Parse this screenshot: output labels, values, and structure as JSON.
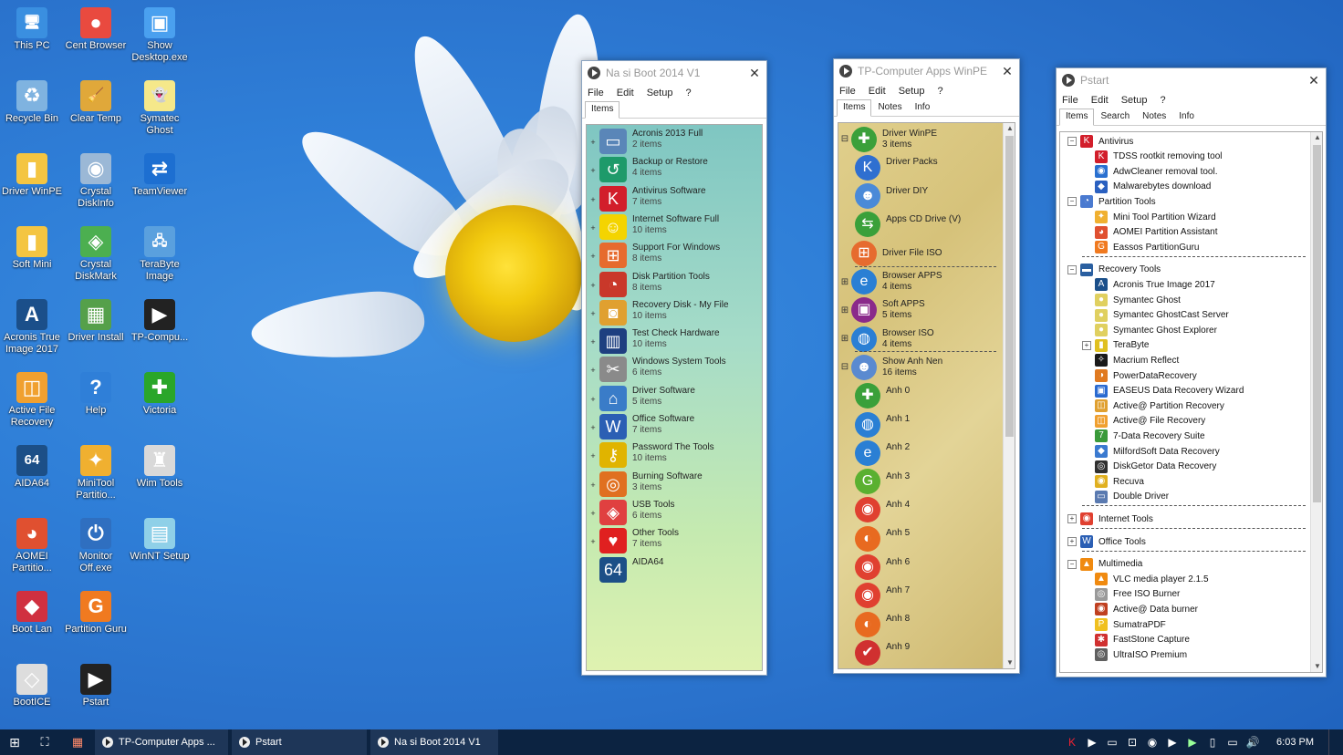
{
  "desktop": {
    "icons": [
      {
        "label": "This PC",
        "icon": "computer-icon",
        "color": "#3a8fe0",
        "glyph": "🖥"
      },
      {
        "label": "Cent Browser",
        "icon": "cent-browser-icon",
        "color": "#e94a3f",
        "glyph": "●"
      },
      {
        "label": "Show Desktop.exe",
        "icon": "show-desktop-icon",
        "color": "#4aa0ef",
        "glyph": "▣"
      },
      {
        "label": "Recycle Bin",
        "icon": "recycle-bin-icon",
        "color": "#7fb3e0",
        "glyph": "♻"
      },
      {
        "label": "Clear Temp",
        "icon": "broom-icon",
        "color": "#e0a83a",
        "glyph": "🧹"
      },
      {
        "label": "Symatec Ghost",
        "icon": "ghost-icon",
        "color": "#f5e88a",
        "glyph": "👻"
      },
      {
        "label": "Driver WinPE",
        "icon": "folder-icon",
        "color": "#f4c542",
        "glyph": "▮"
      },
      {
        "label": "Crystal DiskInfo",
        "icon": "crystal-diskinfo-icon",
        "color": "#9bb8d6",
        "glyph": "◉"
      },
      {
        "label": "TeamViewer",
        "icon": "teamviewer-icon",
        "color": "#1d6fd1",
        "glyph": "⇄"
      },
      {
        "label": "Soft Mini",
        "icon": "folder-icon",
        "color": "#f4c542",
        "glyph": "▮"
      },
      {
        "label": "Crystal DiskMark",
        "icon": "crystal-diskmark-icon",
        "color": "#4caf50",
        "glyph": "◈"
      },
      {
        "label": "TeraByte Image",
        "icon": "terabyte-icon",
        "color": "#5aa0de",
        "glyph": "🖧"
      },
      {
        "label": "Acronis True Image 2017",
        "icon": "acronis-icon",
        "color": "#1b4f8a",
        "glyph": "A"
      },
      {
        "label": "Driver Install",
        "icon": "driver-install-icon",
        "color": "#55a04a",
        "glyph": "▦"
      },
      {
        "label": "TP-Compu...",
        "icon": "play-icon",
        "color": "#222222",
        "glyph": "▶"
      },
      {
        "label": "Active File Recovery",
        "icon": "active-file-recovery-icon",
        "color": "#f0a030",
        "glyph": "◫"
      },
      {
        "label": "Help",
        "icon": "help-icon",
        "color": "#2f7fd8",
        "glyph": "?"
      },
      {
        "label": "Victoria",
        "icon": "victoria-plus-icon",
        "color": "#2aa62a",
        "glyph": "✚"
      },
      {
        "label": "AIDA64",
        "icon": "aida64-icon",
        "color": "#1c4f87",
        "glyph": "64"
      },
      {
        "label": "MiniTool Partitio...",
        "icon": "minitool-icon",
        "color": "#f0b030",
        "glyph": "✦"
      },
      {
        "label": "Wim Tools",
        "icon": "wim-tools-icon",
        "color": "#d9d9d9",
        "glyph": "♜"
      },
      {
        "label": "AOMEI Partitio...",
        "icon": "aomei-icon",
        "color": "#e05030",
        "glyph": "◕"
      },
      {
        "label": "Monitor Off.exe",
        "icon": "power-icon",
        "color": "#2f6fc0",
        "glyph": "⏻"
      },
      {
        "label": "WinNT Setup",
        "icon": "winnt-setup-icon",
        "color": "#8fd0e8",
        "glyph": "▤"
      },
      {
        "label": "Boot Lan",
        "icon": "boot-lan-icon",
        "color": "#d03040",
        "glyph": "◆"
      },
      {
        "label": "Partition Guru",
        "icon": "partition-guru-icon",
        "color": "#f07a20",
        "glyph": "G"
      },
      {
        "label": "",
        "icon": "blank-icon",
        "color": "#2f7fd8",
        "glyph": ""
      },
      {
        "label": "BootICE",
        "icon": "bootice-icon",
        "color": "#dddddd",
        "glyph": "◇"
      },
      {
        "label": "Pstart",
        "icon": "play-icon",
        "color": "#222222",
        "glyph": "▶"
      }
    ]
  },
  "windows": {
    "nasiboot": {
      "title": "Na si Boot 2014 V1",
      "menu": [
        "File",
        "Edit",
        "Setup",
        "?"
      ],
      "tabs": [
        "Items"
      ],
      "rows": [
        {
          "name": "Acronis 2013 Full",
          "count": "2 items",
          "icon": "acronis-icon",
          "color": "#5a86b8",
          "glyph": "▭"
        },
        {
          "name": "Backup or Restore",
          "count": "4 items",
          "icon": "backup-icon",
          "color": "#1e9a6a",
          "glyph": "↺"
        },
        {
          "name": "Antivirus Software",
          "count": "7 items",
          "icon": "kaspersky-icon",
          "color": "#d21e2b",
          "glyph": "K"
        },
        {
          "name": "Internet Software Full",
          "count": "10 items",
          "icon": "smiley-icon",
          "color": "#f4d400",
          "glyph": "☺"
        },
        {
          "name": "Support For Windows",
          "count": "8 items",
          "icon": "windows-flag-icon",
          "color": "#e66b2e",
          "glyph": "⊞"
        },
        {
          "name": "Disk Partition Tools",
          "count": "8 items",
          "icon": "partition-icon",
          "color": "#c9382a",
          "glyph": "◔"
        },
        {
          "name": "Recovery Disk - My File",
          "count": "10 items",
          "icon": "recovery-disk-icon",
          "color": "#e0a030",
          "glyph": "◙"
        },
        {
          "name": "Test Check Hardware",
          "count": "10 items",
          "icon": "hardware-test-icon",
          "color": "#1e3f80",
          "glyph": "▥"
        },
        {
          "name": "Windows System Tools",
          "count": "6 items",
          "icon": "tools-icon",
          "color": "#8a8a8a",
          "glyph": "✂"
        },
        {
          "name": "Driver Software",
          "count": "5 items",
          "icon": "driver-icon",
          "color": "#3a7cc8",
          "glyph": "⌂"
        },
        {
          "name": "Office Software",
          "count": "7 items",
          "icon": "word-icon",
          "color": "#2b5fb4",
          "glyph": "W"
        },
        {
          "name": "Password The Tools",
          "count": "10 items",
          "icon": "key-icon",
          "color": "#e0b400",
          "glyph": "⚷"
        },
        {
          "name": "Burning Software",
          "count": "3 items",
          "icon": "disc-burn-icon",
          "color": "#e07020",
          "glyph": "◎"
        },
        {
          "name": "USB Tools",
          "count": "6 items",
          "icon": "usb-icon",
          "color": "#e04040",
          "glyph": "◈"
        },
        {
          "name": "Other Tools",
          "count": "7 items",
          "icon": "heart-icon",
          "color": "#e02020",
          "glyph": "♥"
        },
        {
          "name": "AIDA64",
          "count": "",
          "icon": "aida64-icon",
          "color": "#1c4f87",
          "glyph": "64"
        }
      ]
    },
    "tpcomputer": {
      "title": "TP-Computer Apps WinPE",
      "menu": [
        "File",
        "Edit",
        "Setup",
        "?"
      ],
      "tabs": [
        "Items",
        "Notes",
        "Info"
      ],
      "groups": [
        {
          "name": "Driver WinPE",
          "count": "3 items",
          "icon": "plus-green-icon",
          "color": "#3aa03a",
          "glyph": "✚",
          "expand": "−",
          "children": [
            {
              "name": "Driver Packs",
              "icon": "kde-icon",
              "color": "#2f6fd0",
              "glyph": "K"
            },
            {
              "name": "Driver DIY",
              "icon": "finder-icon",
              "color": "#4a8ad8",
              "glyph": "☻"
            },
            {
              "name": "Apps CD Drive (V)",
              "icon": "arrows-icon",
              "color": "#3aa03a",
              "glyph": "⇆"
            }
          ]
        },
        {
          "name": "Driver File ISO",
          "count": "",
          "icon": "windows-flag-icon",
          "color": "#e66b2e",
          "glyph": "⊞",
          "expand": "",
          "children": []
        },
        {
          "name": "Browser APPS",
          "count": "4 items",
          "icon": "ie-icon",
          "color": "#2a7fd4",
          "glyph": "e",
          "expand": "+",
          "children": []
        },
        {
          "name": "Soft APPS",
          "count": "5 items",
          "icon": "apps-icon",
          "color": "#8a2a8a",
          "glyph": "▣",
          "expand": "+",
          "children": []
        },
        {
          "name": "Browser ISO",
          "count": "4 items",
          "icon": "globe-icon",
          "color": "#2a7fd4",
          "glyph": "◍",
          "expand": "+",
          "children": []
        },
        {
          "name": "Show Anh Nen",
          "count": "16 items",
          "icon": "users-icon",
          "color": "#5a8ad0",
          "glyph": "☻",
          "expand": "−",
          "children": [
            {
              "name": "Anh 0",
              "icon": "plus-green-icon",
              "color": "#3aa03a",
              "glyph": "✚"
            },
            {
              "name": "Anh 1",
              "icon": "globe-icon",
              "color": "#2a7fd4",
              "glyph": "◍"
            },
            {
              "name": "Anh 2",
              "icon": "ie-icon",
              "color": "#2a7fd4",
              "glyph": "e"
            },
            {
              "name": "Anh 3",
              "icon": "g-green-icon",
              "color": "#5ab030",
              "glyph": "G"
            },
            {
              "name": "Anh 4",
              "icon": "chrome-icon",
              "color": "#e04030",
              "glyph": "◉"
            },
            {
              "name": "Anh 5",
              "icon": "firefox-icon",
              "color": "#e86a20",
              "glyph": "◐"
            },
            {
              "name": "Anh 6",
              "icon": "chrome-icon",
              "color": "#e04030",
              "glyph": "◉"
            },
            {
              "name": "Anh 7",
              "icon": "chrome-icon",
              "color": "#e04030",
              "glyph": "◉"
            },
            {
              "name": "Anh 8",
              "icon": "firefox-icon",
              "color": "#e86a20",
              "glyph": "◐"
            },
            {
              "name": "Anh 9",
              "icon": "checkmark-icon",
              "color": "#d03030",
              "glyph": "✔"
            }
          ]
        }
      ]
    },
    "pstart": {
      "title": "Pstart",
      "menu": [
        "File",
        "Edit",
        "Setup",
        "?"
      ],
      "tabs": [
        "Items",
        "Search",
        "Notes",
        "Info"
      ],
      "tree": [
        {
          "level": 0,
          "exp": "−",
          "label": "Antivirus",
          "icon": "kaspersky-icon",
          "color": "#d21e2b",
          "glyph": "K"
        },
        {
          "level": 1,
          "exp": "",
          "label": "TDSS rootkit removing tool",
          "icon": "kaspersky-icon",
          "color": "#d21e2b",
          "glyph": "K"
        },
        {
          "level": 1,
          "exp": "",
          "label": "AdwCleaner removal tool.",
          "icon": "adwcleaner-icon",
          "color": "#2a70d0",
          "glyph": "◉"
        },
        {
          "level": 1,
          "exp": "",
          "label": "Malwarebytes download",
          "icon": "malwarebytes-icon",
          "color": "#2a60c0",
          "glyph": "◆"
        },
        {
          "level": 0,
          "exp": "−",
          "label": "Partition Tools",
          "icon": "partition-icon",
          "color": "#4a7ad0",
          "glyph": "◔"
        },
        {
          "level": 1,
          "exp": "",
          "label": "Mini Tool Partition Wizard",
          "icon": "minitool-icon",
          "color": "#f0b030",
          "glyph": "✦"
        },
        {
          "level": 1,
          "exp": "",
          "label": "AOMEI Partition Assistant",
          "icon": "aomei-icon",
          "color": "#e05030",
          "glyph": "◕"
        },
        {
          "level": 1,
          "exp": "",
          "label": "Eassos PartitionGuru",
          "icon": "partition-guru-icon",
          "color": "#f07a20",
          "glyph": "G"
        },
        {
          "level": 0,
          "exp": "",
          "label": "",
          "icon": "divider",
          "color": "",
          "glyph": ""
        },
        {
          "level": 0,
          "exp": "−",
          "label": "Recovery Tools",
          "icon": "recovery-icon",
          "color": "#2a5fa0",
          "glyph": "▬"
        },
        {
          "level": 1,
          "exp": "",
          "label": "Acronis True Image 2017",
          "icon": "acronis-icon",
          "color": "#1b4f8a",
          "glyph": "A"
        },
        {
          "level": 1,
          "exp": "",
          "label": "Symantec Ghost",
          "icon": "ghost-icon",
          "color": "#e0d060",
          "glyph": "●"
        },
        {
          "level": 1,
          "exp": "",
          "label": "Symantec GhostCast Server",
          "icon": "ghost-icon",
          "color": "#e0d060",
          "glyph": "●"
        },
        {
          "level": 1,
          "exp": "",
          "label": "Symantec Ghost Explorer",
          "icon": "ghost-icon",
          "color": "#e0d060",
          "glyph": "●"
        },
        {
          "level": 1,
          "exp": "+",
          "label": "TeraByte",
          "icon": "terabyte-icon",
          "color": "#e0c020",
          "glyph": "▮"
        },
        {
          "level": 1,
          "exp": "",
          "label": "Macrium Reflect",
          "icon": "macrium-icon",
          "color": "#1a1a1a",
          "glyph": "✧"
        },
        {
          "level": 1,
          "exp": "",
          "label": "PowerDataRecovery",
          "icon": "powerdata-icon",
          "color": "#e07a20",
          "glyph": "◑"
        },
        {
          "level": 1,
          "exp": "",
          "label": "EASEUS Data Recovery Wizard",
          "icon": "easeus-icon",
          "color": "#2a6ad0",
          "glyph": "▣"
        },
        {
          "level": 1,
          "exp": "",
          "label": "Active@ Partition Recovery",
          "icon": "active-partition-icon",
          "color": "#e0a030",
          "glyph": "◫"
        },
        {
          "level": 1,
          "exp": "",
          "label": "Active@ File Recovery",
          "icon": "active-file-recovery-icon",
          "color": "#f0a030",
          "glyph": "◫"
        },
        {
          "level": 1,
          "exp": "",
          "label": "7-Data Recovery Suite",
          "icon": "7data-icon",
          "color": "#3a9a3a",
          "glyph": "7"
        },
        {
          "level": 1,
          "exp": "",
          "label": "MilfordSoft Data Recovery",
          "icon": "milfordsoft-icon",
          "color": "#3a7ad0",
          "glyph": "◆"
        },
        {
          "level": 1,
          "exp": "",
          "label": "DiskGetor Data Recovery",
          "icon": "diskgetor-icon",
          "color": "#303030",
          "glyph": "◎"
        },
        {
          "level": 1,
          "exp": "",
          "label": "Recuva",
          "icon": "recuva-icon",
          "color": "#e0b020",
          "glyph": "◉"
        },
        {
          "level": 1,
          "exp": "",
          "label": "Double Driver",
          "icon": "double-driver-icon",
          "color": "#5a7ab0",
          "glyph": "▭"
        },
        {
          "level": 0,
          "exp": "",
          "label": "",
          "icon": "divider",
          "color": "",
          "glyph": ""
        },
        {
          "level": 0,
          "exp": "+",
          "label": "Internet Tools",
          "icon": "chrome-icon",
          "color": "#e04030",
          "glyph": "◉"
        },
        {
          "level": 0,
          "exp": "",
          "label": "",
          "icon": "divider",
          "color": "",
          "glyph": ""
        },
        {
          "level": 0,
          "exp": "+",
          "label": "Office Tools",
          "icon": "word-icon",
          "color": "#2b5fb4",
          "glyph": "W"
        },
        {
          "level": 0,
          "exp": "",
          "label": "",
          "icon": "divider",
          "color": "",
          "glyph": ""
        },
        {
          "level": 0,
          "exp": "−",
          "label": "Multimedia",
          "icon": "vlc-icon",
          "color": "#f08a10",
          "glyph": "▲"
        },
        {
          "level": 1,
          "exp": "",
          "label": "VLC media player 2.1.5",
          "icon": "vlc-icon",
          "color": "#f08a10",
          "glyph": "▲"
        },
        {
          "level": 1,
          "exp": "",
          "label": "Free ISO Burner",
          "icon": "disc-icon",
          "color": "#9a9a9a",
          "glyph": "◎"
        },
        {
          "level": 1,
          "exp": "",
          "label": "Active@ Data burner",
          "icon": "data-burner-icon",
          "color": "#c04020",
          "glyph": "◉"
        },
        {
          "level": 1,
          "exp": "",
          "label": "SumatraPDF",
          "icon": "sumatra-icon",
          "color": "#f0c020",
          "glyph": "P"
        },
        {
          "level": 1,
          "exp": "",
          "label": "FastStone Capture",
          "icon": "faststone-icon",
          "color": "#d03030",
          "glyph": "✱"
        },
        {
          "level": 1,
          "exp": "",
          "label": "UltraISO Premium",
          "icon": "ultraiso-icon",
          "color": "#606060",
          "glyph": "◎"
        }
      ]
    }
  },
  "taskbar": {
    "buttons": [
      {
        "label": "TP-Computer Apps ..."
      },
      {
        "label": "Pstart"
      },
      {
        "label": "Na si Boot 2014 V1"
      }
    ],
    "clock": "6:03 PM"
  }
}
